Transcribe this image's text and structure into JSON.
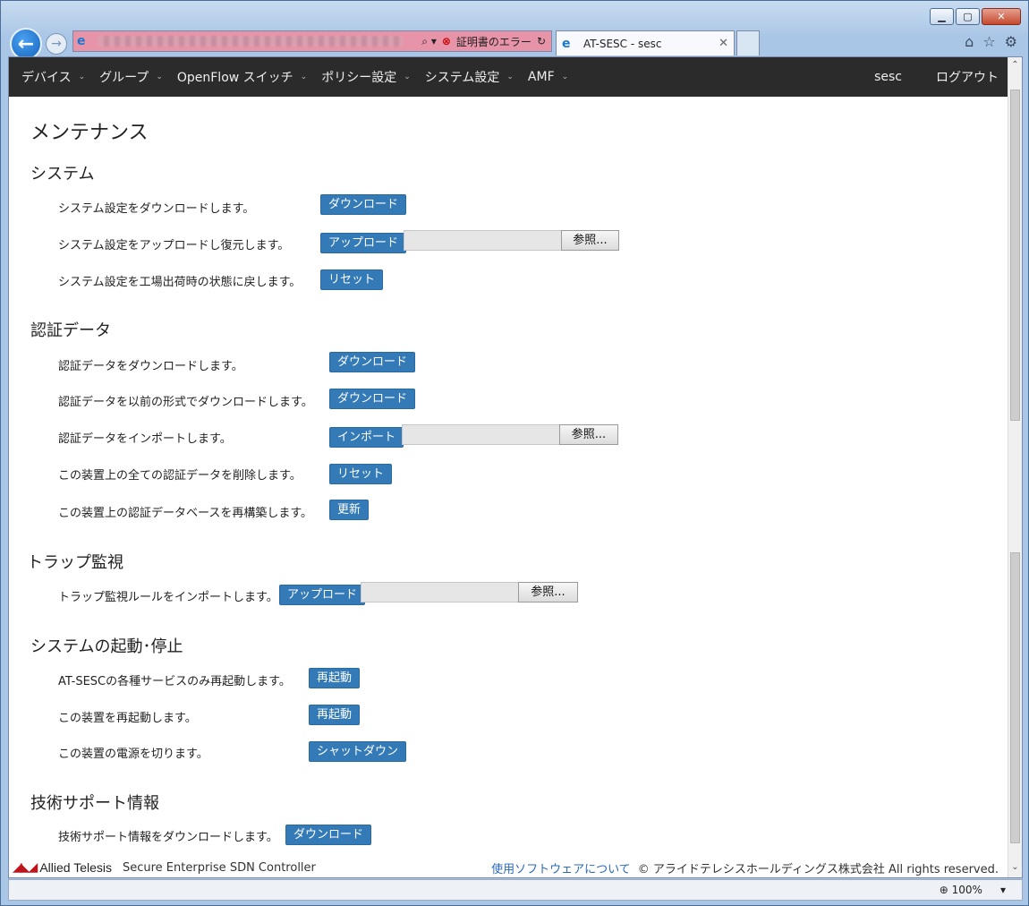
{
  "browser": {
    "address_suffix": "⌕ ▾",
    "cert_error": "証明書のエラー",
    "tab_title": "AT-SESC - sesc",
    "zoom": "100%"
  },
  "nav": {
    "items": [
      {
        "label": "デバイス"
      },
      {
        "label": "グループ"
      },
      {
        "label": "OpenFlow スイッチ"
      },
      {
        "label": "ポリシー設定"
      },
      {
        "label": "システム設定"
      },
      {
        "label": "AMF"
      }
    ],
    "user": "sesc",
    "logout": "ログアウト"
  },
  "page": {
    "title": "メンテナンス",
    "browse_label": "参照...",
    "sections": {
      "system": {
        "heading": "システム",
        "rows": [
          {
            "label": "システム設定をダウンロードします。",
            "button": "ダウンロード"
          },
          {
            "label": "システム設定をアップロードし復元します。",
            "button": "アップロード"
          },
          {
            "label": "システム設定を工場出荷時の状態に戻します。",
            "button": "リセット"
          }
        ]
      },
      "auth": {
        "heading": "認証データ",
        "rows": [
          {
            "label": "認証データをダウンロードします。",
            "button": "ダウンロード"
          },
          {
            "label": "認証データを以前の形式でダウンロードします。",
            "button": "ダウンロード"
          },
          {
            "label": "認証データをインポートします。",
            "button": "インポート"
          },
          {
            "label": "この装置上の全ての認証データを削除します。",
            "button": "リセット"
          },
          {
            "label": "この装置上の認証データベースを再構築します。",
            "button": "更新"
          }
        ]
      },
      "trap": {
        "heading": "トラップ監視",
        "rows": [
          {
            "label": "トラップ監視ルールをインポートします。",
            "button": "アップロード"
          }
        ]
      },
      "power": {
        "heading": "システムの起動･停止",
        "rows": [
          {
            "label": "AT-SESCの各種サービスのみ再起動します。",
            "button": "再起動"
          },
          {
            "label": "この装置を再起動します。",
            "button": "再起動"
          },
          {
            "label": "この装置の電源を切ります。",
            "button": "シャットダウン"
          }
        ]
      },
      "support": {
        "heading": "技術サポート情報",
        "rows": [
          {
            "label": "技術サポート情報をダウンロードします。",
            "button": "ダウンロード"
          }
        ]
      }
    }
  },
  "footer": {
    "logo_text": "Allied Telesis",
    "product": "Secure Enterprise SDN Controller",
    "software_link": "使用ソフトウェアについて",
    "copyright": "© アライドテレシスホールディングス株式会社 All rights reserved."
  }
}
